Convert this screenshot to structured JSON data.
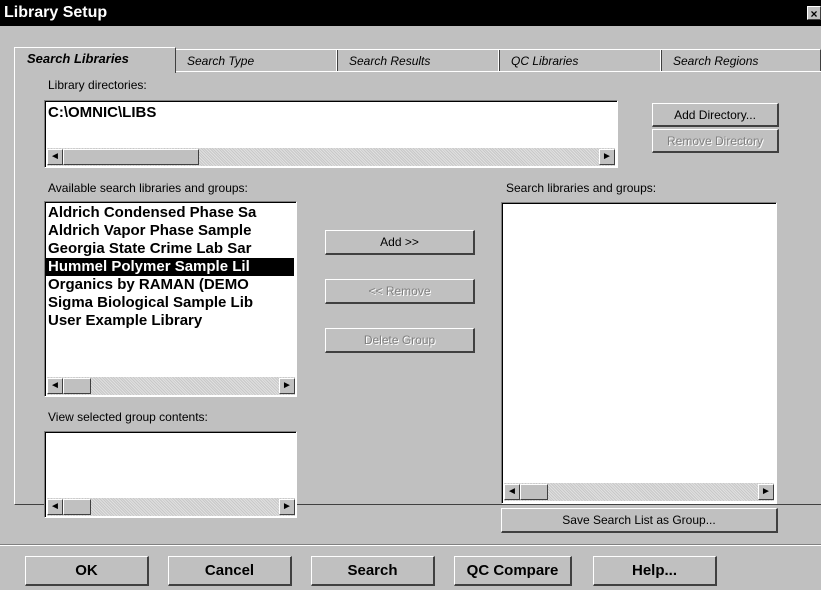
{
  "window": {
    "title": "Library Setup",
    "close_glyph": "×"
  },
  "tabs": [
    {
      "label": "Search Libraries",
      "active": true
    },
    {
      "label": "Search Type",
      "active": false
    },
    {
      "label": "Search Results",
      "active": false
    },
    {
      "label": "QC Libraries",
      "active": false
    },
    {
      "label": "Search Regions",
      "active": false
    }
  ],
  "library_directories": {
    "label": "Library directories:",
    "value": "C:\\OMNIC\\LIBS",
    "add_button": "Add Directory...",
    "remove_button": "Remove Directory"
  },
  "available": {
    "label": "Available search libraries and groups:",
    "items": [
      {
        "text": "Aldrich Condensed Phase Sa",
        "selected": false
      },
      {
        "text": "Aldrich Vapor Phase Sample",
        "selected": false
      },
      {
        "text": "Georgia State Crime Lab Sar",
        "selected": false
      },
      {
        "text": "Hummel Polymer Sample Lil",
        "selected": true
      },
      {
        "text": "Organics by RAMAN (DEMO",
        "selected": false
      },
      {
        "text": "Sigma Biological Sample Lib",
        "selected": false
      },
      {
        "text": "User Example Library",
        "selected": false
      }
    ]
  },
  "actions": {
    "add": "Add >>",
    "remove": "<< Remove",
    "delete_group": "Delete Group"
  },
  "group_contents": {
    "label": "View selected group contents:"
  },
  "search_list": {
    "label": "Search libraries and groups:",
    "save_button": "Save Search List as Group..."
  },
  "scroll_glyphs": {
    "left": "◄",
    "right": "►"
  },
  "footer": {
    "ok": "OK",
    "cancel": "Cancel",
    "search": "Search",
    "qc_compare": "QC Compare",
    "help": "Help..."
  }
}
